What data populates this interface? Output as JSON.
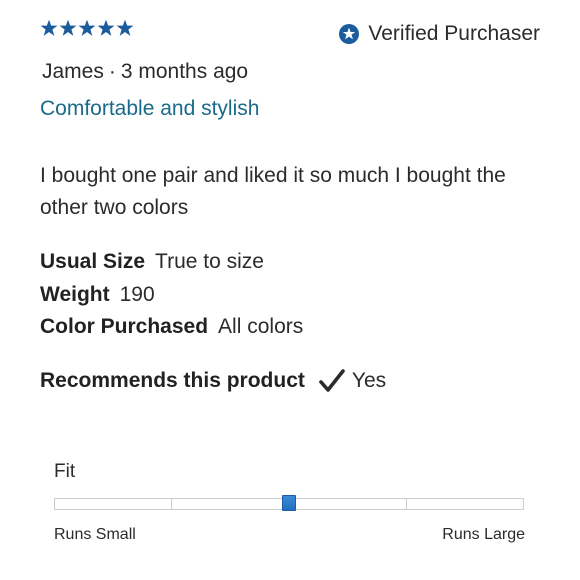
{
  "review": {
    "rating": 5,
    "rating_max": 5,
    "star_color": "#1a5c9c",
    "verified_label": "Verified Purchaser",
    "author": "James",
    "separator": "·",
    "date": "3 months ago",
    "headline": "Comfortable and stylish",
    "headline_color": "#1a6a8a",
    "body": "I bought one pair and liked it so much I bought the other two colors",
    "attributes": [
      {
        "key": "Usual Size",
        "value": "True to size"
      },
      {
        "key": "Weight",
        "value": "190"
      },
      {
        "key": "Color Purchased",
        "value": "All colors"
      }
    ],
    "recommend": {
      "label": "Recommends this product",
      "icon": "checkmark-icon",
      "value": "Yes"
    },
    "fit": {
      "label": "Fit",
      "min_label": "Runs Small",
      "max_label": "Runs Large",
      "value": 0.5,
      "segments": 4,
      "marker_color": "#1f6fc0"
    }
  }
}
